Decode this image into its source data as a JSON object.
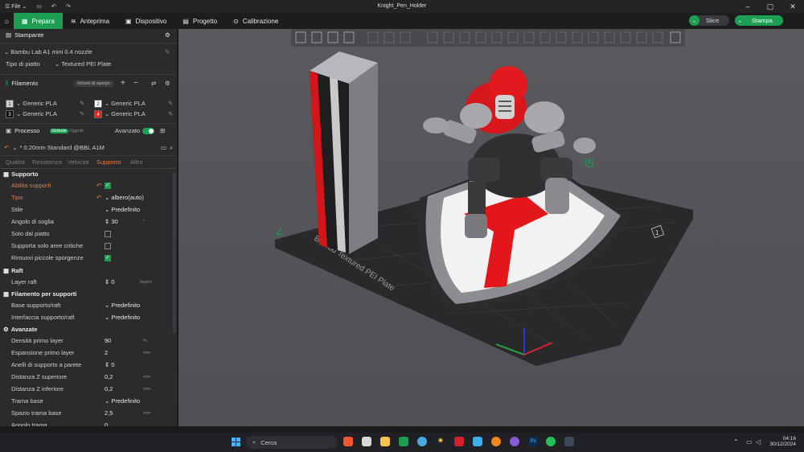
{
  "titlebar": {
    "file_label": "File",
    "window_title": "Knight_Pen_Holder"
  },
  "tabs": [
    {
      "label": "Prepara"
    },
    {
      "label": "Anteprima"
    },
    {
      "label": "Dispositivo"
    },
    {
      "label": "Progetto"
    },
    {
      "label": "Calibrazione"
    }
  ],
  "actions": {
    "slice": "Slice",
    "print": "Stampa"
  },
  "printer": {
    "section": "Stampante",
    "name": "Bambu Lab A1 mini 0.4 nozzle",
    "plate_label": "Tipo di piatto",
    "plate_value": "Textured PEI Plate"
  },
  "filament": {
    "section": "Filamento",
    "flush_label": "Volumi di spurgo",
    "slots": [
      {
        "num": "1",
        "name": "Generic PLA",
        "color": "#d0d0d0"
      },
      {
        "num": "2",
        "name": "Generic PLA",
        "color": "#ffffff"
      },
      {
        "num": "3",
        "name": "Generic PLA",
        "color": "#111111"
      },
      {
        "num": "4",
        "name": "Generic PLA",
        "color": "#e8221b"
      }
    ]
  },
  "process": {
    "section": "Processo",
    "global": "Globale",
    "objects": "Oggetti",
    "advanced": "Avanzato",
    "profile": "* 0.20mm Standard @BBL A1M"
  },
  "subtabs": [
    "Qualità",
    "Resistenza",
    "Velocità",
    "Supporto",
    "Altro"
  ],
  "support": {
    "header": "Supporto",
    "enable": "Abilita supporti",
    "type_label": "Tipo",
    "type_value": "albero(auto)",
    "style_label": "Stile",
    "style_value": "Predefinito",
    "threshold_label": "Angolo di soglia",
    "threshold_value": "30",
    "threshold_unit": "°",
    "plate_only": "Solo dal piatto",
    "critical_only": "Supporta solo aree critiche",
    "remove_small": "Rimuovi piccole sporgenze"
  },
  "raft": {
    "header": "Raft",
    "layer_label": "Layer raft",
    "layer_value": "0",
    "layer_unit": "layers"
  },
  "filsupport": {
    "header": "Filamento per supporti",
    "base_label": "Base supporto/raft",
    "base_value": "Predefinito",
    "iface_label": "Interfaccia supporto/raft",
    "iface_value": "Predefinito"
  },
  "advanced": {
    "header": "Avanzate",
    "rows": [
      {
        "label": "Densità primo layer",
        "value": "90",
        "unit": "%"
      },
      {
        "label": "Espansione primo layer",
        "value": "2",
        "unit": "mm"
      },
      {
        "label": "Anelli di supporto a parete",
        "value": "0",
        "unit": ""
      },
      {
        "label": "Distanza Z superiore",
        "value": "0,2",
        "unit": "mm"
      },
      {
        "label": "Distanza Z inferiore",
        "value": "0,2",
        "unit": "mm"
      },
      {
        "label": "Trama base",
        "value": "Predefinito",
        "unit": ""
      },
      {
        "label": "Spazio trama base",
        "value": "2,5",
        "unit": "mm"
      },
      {
        "label": "Angolo trama",
        "value": "0",
        "unit": ""
      }
    ]
  },
  "plate": {
    "text": "Bambu Textured PEI Plate",
    "number": "1"
  },
  "taskbar": {
    "search": "Cerca",
    "time": "04:16",
    "date": "30/12/2024"
  }
}
